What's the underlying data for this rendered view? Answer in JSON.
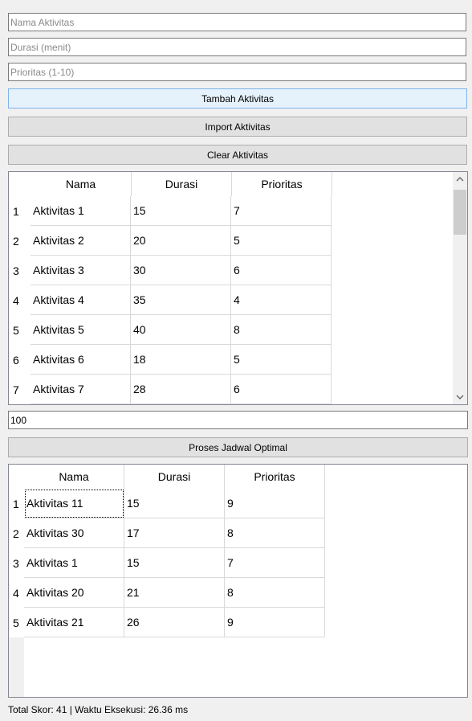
{
  "form": {
    "name_placeholder": "Nama Aktivitas",
    "duration_placeholder": "Durasi (menit)",
    "priority_placeholder": "Prioritas (1-10)",
    "add_button": "Tambah Aktivitas",
    "import_button": "Import Aktivitas",
    "clear_button": "Clear Aktivitas"
  },
  "activities_table": {
    "headers": [
      "Nama",
      "Durasi",
      "Prioritas"
    ],
    "rows": [
      {
        "num": "1",
        "nama": "Aktivitas 1",
        "durasi": "15",
        "prioritas": "7"
      },
      {
        "num": "2",
        "nama": "Aktivitas 2",
        "durasi": "20",
        "prioritas": "5"
      },
      {
        "num": "3",
        "nama": "Aktivitas 3",
        "durasi": "30",
        "prioritas": "6"
      },
      {
        "num": "4",
        "nama": "Aktivitas 4",
        "durasi": "35",
        "prioritas": "4"
      },
      {
        "num": "5",
        "nama": "Aktivitas 5",
        "durasi": "40",
        "prioritas": "8"
      },
      {
        "num": "6",
        "nama": "Aktivitas 6",
        "durasi": "18",
        "prioritas": "5"
      },
      {
        "num": "7",
        "nama": "Aktivitas 7",
        "durasi": "28",
        "prioritas": "6"
      }
    ]
  },
  "time_limit": {
    "value": "100"
  },
  "process_button": "Proses Jadwal Optimal",
  "result_table": {
    "headers": [
      "Nama",
      "Durasi",
      "Prioritas"
    ],
    "rows": [
      {
        "num": "1",
        "nama": "Aktivitas 11",
        "durasi": "15",
        "prioritas": "9"
      },
      {
        "num": "2",
        "nama": "Aktivitas 30",
        "durasi": "17",
        "prioritas": "8"
      },
      {
        "num": "3",
        "nama": "Aktivitas 1",
        "durasi": "15",
        "prioritas": "7"
      },
      {
        "num": "4",
        "nama": "Aktivitas 20",
        "durasi": "21",
        "prioritas": "8"
      },
      {
        "num": "5",
        "nama": "Aktivitas 21",
        "durasi": "26",
        "prioritas": "9"
      }
    ]
  },
  "status": "Total Skor: 41 | Waktu Eksekusi: 26.36 ms",
  "icons": {
    "scroll_up": "chevron-up-icon",
    "scroll_down": "chevron-down-icon"
  }
}
